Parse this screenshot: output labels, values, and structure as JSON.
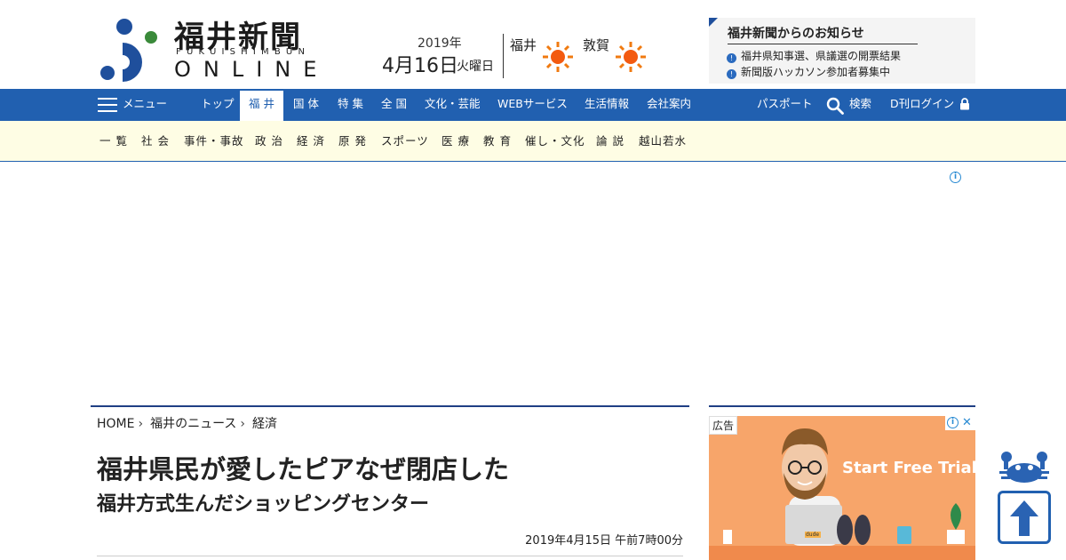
{
  "header": {
    "logo_jp": "福井新聞",
    "logo_sub": "FUKUISHIMBUN",
    "logo_online": "ONLINE",
    "date_year": "2019年",
    "date_main": "4月16日",
    "date_dow": "火曜日",
    "weather": [
      {
        "city": "福井",
        "icon": "sun-icon"
      },
      {
        "city": "敦賀",
        "icon": "sun-icon"
      }
    ],
    "notice": {
      "title": "福井新聞からのお知らせ",
      "items": [
        "福井県知事選、県議選の開票結果",
        "新聞版ハッカソン参加者募集中"
      ]
    }
  },
  "mainnav": {
    "menu": "メニュー",
    "top": "トップ",
    "items": [
      "福 井",
      "国 体",
      "特 集",
      "全 国",
      "文化・芸能",
      "WEBサービス",
      "生活情報",
      "会社案内"
    ],
    "active": "福 井",
    "passport": "パスポート",
    "search": "検索",
    "login": "D刊ログイン"
  },
  "subnav": {
    "items": [
      "一 覧",
      "社 会",
      "事件・事故",
      "政 治",
      "経 済",
      "原 発",
      "スポーツ",
      "医 療",
      "教 育",
      "催し・文化",
      "論 説",
      "越山若水"
    ]
  },
  "article": {
    "breadcrumb": [
      "HOME",
      "福井のニュース",
      "経済"
    ],
    "title": "福井県民が愛したピアなぜ閉店した",
    "subtitle": "福井方式生んだショッピングセンター",
    "pubdate": "2019年4月15日 午前7時00分"
  },
  "side_ad": {
    "label": "広告",
    "cta": "Start Free Trial",
    "laptop_text": "dude"
  },
  "colors": {
    "nav_blue": "#2160b0",
    "subnav_bg": "#fefde4",
    "ad_bg": "#f7a56a",
    "logo_green": "#3a8a3a",
    "logo_blue": "#1f4f9c"
  }
}
